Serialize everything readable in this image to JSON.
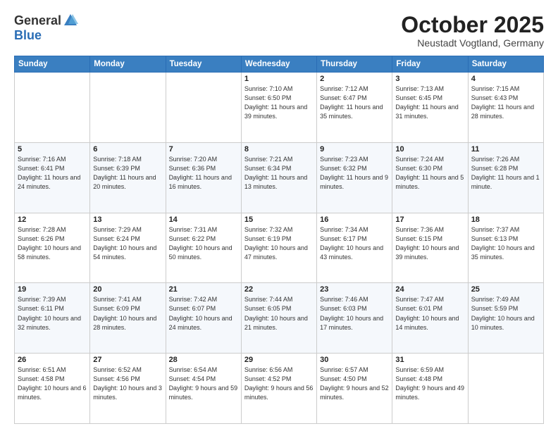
{
  "header": {
    "logo": {
      "general": "General",
      "blue": "Blue"
    },
    "title": "October 2025",
    "location": "Neustadt Vogtland, Germany"
  },
  "weekdays": [
    "Sunday",
    "Monday",
    "Tuesday",
    "Wednesday",
    "Thursday",
    "Friday",
    "Saturday"
  ],
  "weeks": [
    [
      {
        "day": "",
        "sunrise": "",
        "sunset": "",
        "daylight": ""
      },
      {
        "day": "",
        "sunrise": "",
        "sunset": "",
        "daylight": ""
      },
      {
        "day": "",
        "sunrise": "",
        "sunset": "",
        "daylight": ""
      },
      {
        "day": "1",
        "sunrise": "Sunrise: 7:10 AM",
        "sunset": "Sunset: 6:50 PM",
        "daylight": "Daylight: 11 hours and 39 minutes."
      },
      {
        "day": "2",
        "sunrise": "Sunrise: 7:12 AM",
        "sunset": "Sunset: 6:47 PM",
        "daylight": "Daylight: 11 hours and 35 minutes."
      },
      {
        "day": "3",
        "sunrise": "Sunrise: 7:13 AM",
        "sunset": "Sunset: 6:45 PM",
        "daylight": "Daylight: 11 hours and 31 minutes."
      },
      {
        "day": "4",
        "sunrise": "Sunrise: 7:15 AM",
        "sunset": "Sunset: 6:43 PM",
        "daylight": "Daylight: 11 hours and 28 minutes."
      }
    ],
    [
      {
        "day": "5",
        "sunrise": "Sunrise: 7:16 AM",
        "sunset": "Sunset: 6:41 PM",
        "daylight": "Daylight: 11 hours and 24 minutes."
      },
      {
        "day": "6",
        "sunrise": "Sunrise: 7:18 AM",
        "sunset": "Sunset: 6:39 PM",
        "daylight": "Daylight: 11 hours and 20 minutes."
      },
      {
        "day": "7",
        "sunrise": "Sunrise: 7:20 AM",
        "sunset": "Sunset: 6:36 PM",
        "daylight": "Daylight: 11 hours and 16 minutes."
      },
      {
        "day": "8",
        "sunrise": "Sunrise: 7:21 AM",
        "sunset": "Sunset: 6:34 PM",
        "daylight": "Daylight: 11 hours and 13 minutes."
      },
      {
        "day": "9",
        "sunrise": "Sunrise: 7:23 AM",
        "sunset": "Sunset: 6:32 PM",
        "daylight": "Daylight: 11 hours and 9 minutes."
      },
      {
        "day": "10",
        "sunrise": "Sunrise: 7:24 AM",
        "sunset": "Sunset: 6:30 PM",
        "daylight": "Daylight: 11 hours and 5 minutes."
      },
      {
        "day": "11",
        "sunrise": "Sunrise: 7:26 AM",
        "sunset": "Sunset: 6:28 PM",
        "daylight": "Daylight: 11 hours and 1 minute."
      }
    ],
    [
      {
        "day": "12",
        "sunrise": "Sunrise: 7:28 AM",
        "sunset": "Sunset: 6:26 PM",
        "daylight": "Daylight: 10 hours and 58 minutes."
      },
      {
        "day": "13",
        "sunrise": "Sunrise: 7:29 AM",
        "sunset": "Sunset: 6:24 PM",
        "daylight": "Daylight: 10 hours and 54 minutes."
      },
      {
        "day": "14",
        "sunrise": "Sunrise: 7:31 AM",
        "sunset": "Sunset: 6:22 PM",
        "daylight": "Daylight: 10 hours and 50 minutes."
      },
      {
        "day": "15",
        "sunrise": "Sunrise: 7:32 AM",
        "sunset": "Sunset: 6:19 PM",
        "daylight": "Daylight: 10 hours and 47 minutes."
      },
      {
        "day": "16",
        "sunrise": "Sunrise: 7:34 AM",
        "sunset": "Sunset: 6:17 PM",
        "daylight": "Daylight: 10 hours and 43 minutes."
      },
      {
        "day": "17",
        "sunrise": "Sunrise: 7:36 AM",
        "sunset": "Sunset: 6:15 PM",
        "daylight": "Daylight: 10 hours and 39 minutes."
      },
      {
        "day": "18",
        "sunrise": "Sunrise: 7:37 AM",
        "sunset": "Sunset: 6:13 PM",
        "daylight": "Daylight: 10 hours and 35 minutes."
      }
    ],
    [
      {
        "day": "19",
        "sunrise": "Sunrise: 7:39 AM",
        "sunset": "Sunset: 6:11 PM",
        "daylight": "Daylight: 10 hours and 32 minutes."
      },
      {
        "day": "20",
        "sunrise": "Sunrise: 7:41 AM",
        "sunset": "Sunset: 6:09 PM",
        "daylight": "Daylight: 10 hours and 28 minutes."
      },
      {
        "day": "21",
        "sunrise": "Sunrise: 7:42 AM",
        "sunset": "Sunset: 6:07 PM",
        "daylight": "Daylight: 10 hours and 24 minutes."
      },
      {
        "day": "22",
        "sunrise": "Sunrise: 7:44 AM",
        "sunset": "Sunset: 6:05 PM",
        "daylight": "Daylight: 10 hours and 21 minutes."
      },
      {
        "day": "23",
        "sunrise": "Sunrise: 7:46 AM",
        "sunset": "Sunset: 6:03 PM",
        "daylight": "Daylight: 10 hours and 17 minutes."
      },
      {
        "day": "24",
        "sunrise": "Sunrise: 7:47 AM",
        "sunset": "Sunset: 6:01 PM",
        "daylight": "Daylight: 10 hours and 14 minutes."
      },
      {
        "day": "25",
        "sunrise": "Sunrise: 7:49 AM",
        "sunset": "Sunset: 5:59 PM",
        "daylight": "Daylight: 10 hours and 10 minutes."
      }
    ],
    [
      {
        "day": "26",
        "sunrise": "Sunrise: 6:51 AM",
        "sunset": "Sunset: 4:58 PM",
        "daylight": "Daylight: 10 hours and 6 minutes."
      },
      {
        "day": "27",
        "sunrise": "Sunrise: 6:52 AM",
        "sunset": "Sunset: 4:56 PM",
        "daylight": "Daylight: 10 hours and 3 minutes."
      },
      {
        "day": "28",
        "sunrise": "Sunrise: 6:54 AM",
        "sunset": "Sunset: 4:54 PM",
        "daylight": "Daylight: 9 hours and 59 minutes."
      },
      {
        "day": "29",
        "sunrise": "Sunrise: 6:56 AM",
        "sunset": "Sunset: 4:52 PM",
        "daylight": "Daylight: 9 hours and 56 minutes."
      },
      {
        "day": "30",
        "sunrise": "Sunrise: 6:57 AM",
        "sunset": "Sunset: 4:50 PM",
        "daylight": "Daylight: 9 hours and 52 minutes."
      },
      {
        "day": "31",
        "sunrise": "Sunrise: 6:59 AM",
        "sunset": "Sunset: 4:48 PM",
        "daylight": "Daylight: 9 hours and 49 minutes."
      },
      {
        "day": "",
        "sunrise": "",
        "sunset": "",
        "daylight": ""
      }
    ]
  ]
}
